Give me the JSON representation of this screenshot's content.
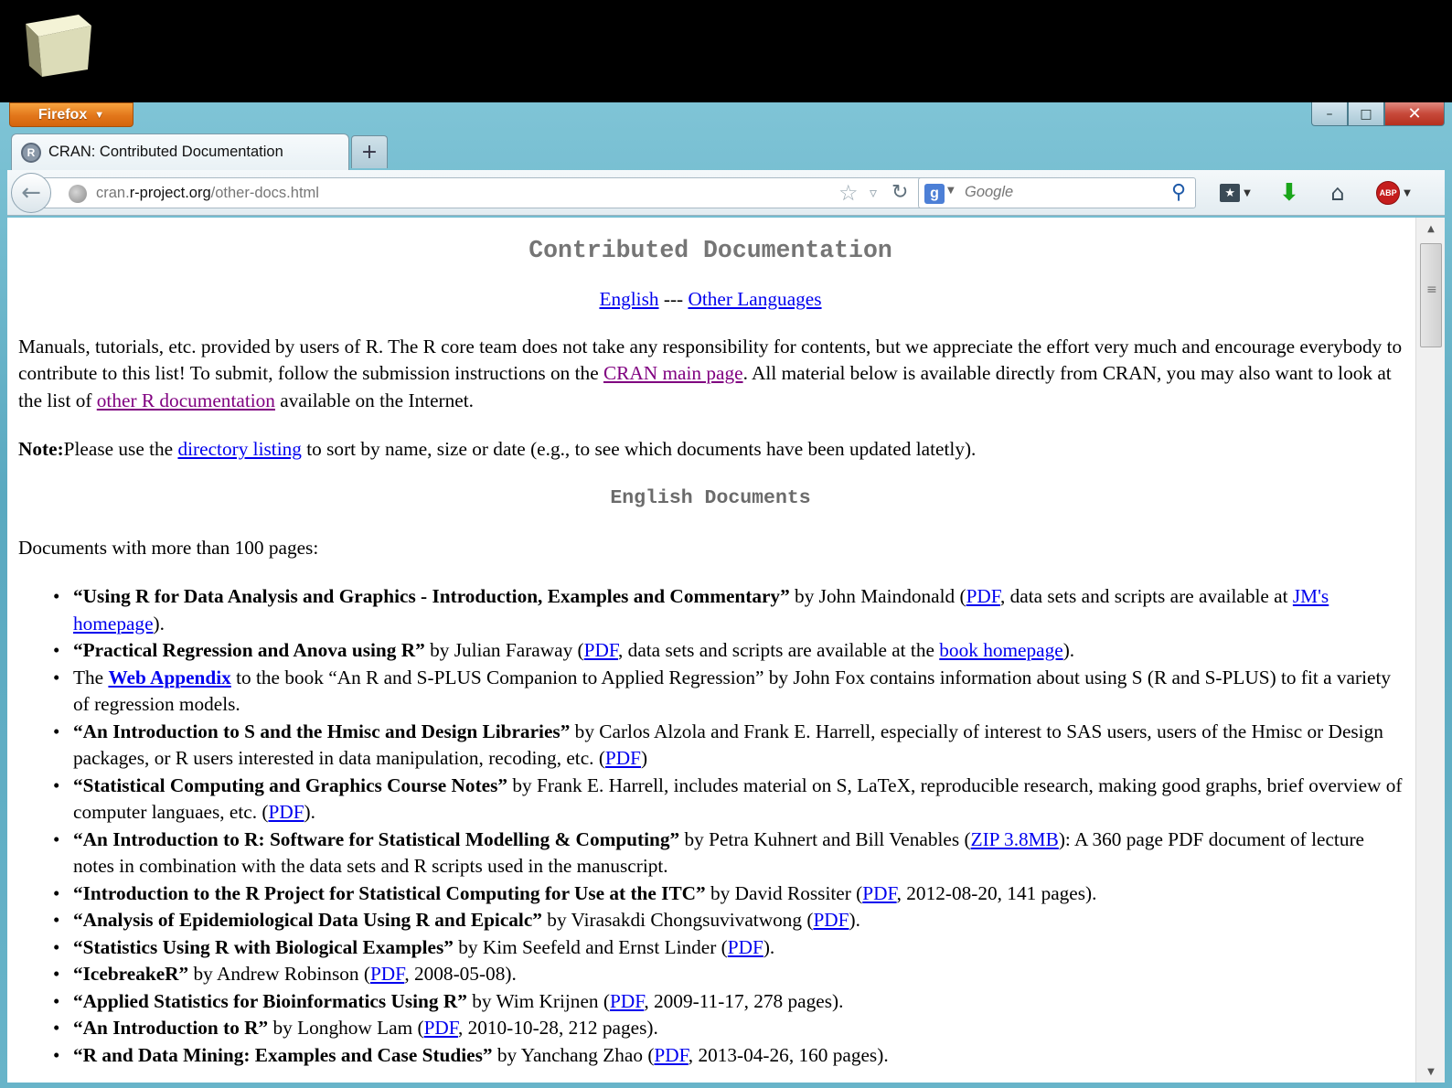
{
  "browser": {
    "app_button": "Firefox",
    "tab_title": "CRAN: Contributed Documentation",
    "url_host_prefix": "cran.",
    "url_host_domain": "r-project.org",
    "url_path": "/other-docs.html",
    "search_placeholder": "Google",
    "new_tab": "+",
    "window_controls": {
      "minimize": "–",
      "maximize": "□",
      "close": "✕"
    }
  },
  "icons": {
    "back": "back-arrow-icon",
    "globe": "site-identity-icon",
    "star": "bookmark-star-icon",
    "reload": "reload-icon",
    "search_engine": "google-icon",
    "search_go": "magnifier-icon",
    "bookmarks": "bookmarks-menu-icon",
    "downloads": "downloads-arrow-icon",
    "home": "home-icon",
    "adblock": "adblock-plus-icon"
  },
  "abp_label": "ABP",
  "page": {
    "title": "Contributed Documentation",
    "lang_links": {
      "english": "English",
      "sep": " --- ",
      "other": "Other Languages"
    },
    "intro": {
      "p1": "Manuals, tutorials, etc. provided by users of R. The R core team does not take any responsibility for contents, but we appreciate the effort very much and encourage everybody to contribute to this list! To submit, follow the submission instructions on the ",
      "link1": "CRAN main page",
      "p2": ". All material below is available directly from CRAN, you may also want to look at the list of ",
      "link2": "other R documentation",
      "p3": " available on the Internet."
    },
    "note": {
      "label": "Note:",
      "p1": "Please use the ",
      "link": "directory listing",
      "p2": " to sort by name, size or date (e.g., to see which documents have been updated latetly)."
    },
    "section_title": "English Documents",
    "lead": "Documents with more than 100 pages:",
    "items": [
      {
        "pre": "",
        "title": "“Using R for Data Analysis and Graphics - Introduction, Examples and Commentary”",
        "mid": " by John Maindonald (",
        "link": "PDF",
        "mid2": ", data sets and scripts are available at ",
        "link2": "JM's homepage",
        "post": ")."
      },
      {
        "pre": "",
        "title": "“Practical Regression and Anova using R”",
        "mid": " by Julian Faraway (",
        "link": "PDF",
        "mid2": ", data sets and scripts are available at the ",
        "link2": "book homepage",
        "post": ")."
      },
      {
        "pre": "The ",
        "title": "",
        "mid": "",
        "link": "Web Appendix",
        "mid2": " to the book “An R and S-PLUS Companion to Applied Regression” by John Fox contains information about using S (R and S-PLUS) to fit a variety of regression models.",
        "link2": "",
        "post": ""
      },
      {
        "pre": "",
        "title": "“An Introduction to S and the Hmisc and Design Libraries”",
        "mid": " by Carlos Alzola and Frank E. Harrell, especially of interest to SAS users, users of the Hmisc or Design packages, or R users interested in data manipulation, recoding, etc. (",
        "link": "PDF",
        "mid2": ")",
        "link2": "",
        "post": ""
      },
      {
        "pre": "",
        "title": "“Statistical Computing and Graphics Course Notes”",
        "mid": " by Frank E. Harrell, includes material on S, LaTeX, reproducible research, making good graphs, brief overview of computer languaes, etc. (",
        "link": "PDF",
        "mid2": ").",
        "link2": "",
        "post": ""
      },
      {
        "pre": "",
        "title": "“An Introduction to R: Software for Statistical Modelling & Computing”",
        "mid": " by Petra Kuhnert and Bill Venables (",
        "link": "ZIP 3.8MB",
        "mid2": "): A 360 page PDF document of lecture notes in combination with the data sets and R scripts used in the manuscript.",
        "link2": "",
        "post": ""
      },
      {
        "pre": "",
        "title": "“Introduction to the R Project for Statistical Computing for Use at the ITC”",
        "mid": " by David Rossiter (",
        "link": "PDF",
        "mid2": ", 2012-08-20, 141 pages).",
        "link2": "",
        "post": ""
      },
      {
        "pre": "",
        "title": "“Analysis of Epidemiological Data Using R and Epicalc”",
        "mid": " by Virasakdi Chongsuvivatwong (",
        "link": "PDF",
        "mid2": ").",
        "link2": "",
        "post": ""
      },
      {
        "pre": "",
        "title": "“Statistics Using R with Biological Examples”",
        "mid": " by Kim Seefeld and Ernst Linder (",
        "link": "PDF",
        "mid2": ").",
        "link2": "",
        "post": ""
      },
      {
        "pre": "",
        "title": "“IcebreakeR”",
        "mid": " by Andrew Robinson (",
        "link": "PDF",
        "mid2": ", 2008-05-08).",
        "link2": "",
        "post": ""
      },
      {
        "pre": "",
        "title": "“Applied Statistics for Bioinformatics Using R”",
        "mid": " by Wim Krijnen (",
        "link": "PDF",
        "mid2": ", 2009-11-17, 278 pages).",
        "link2": "",
        "post": ""
      },
      {
        "pre": "",
        "title": "“An Introduction to R”",
        "mid": " by Longhow Lam (",
        "link": "PDF",
        "mid2": ", 2010-10-28, 212 pages).",
        "link2": "",
        "post": ""
      },
      {
        "pre": "",
        "title": "“R and Data Mining: Examples and Case Studies”",
        "mid": " by Yanchang Zhao (",
        "link": "PDF",
        "mid2": ", 2013-04-26, 160 pages).",
        "link2": "",
        "post": ""
      }
    ]
  },
  "colors": {
    "link": "#0000ee",
    "visited_link": "#800080",
    "heading": "#757575",
    "firefox_orange": "#e2761a"
  }
}
